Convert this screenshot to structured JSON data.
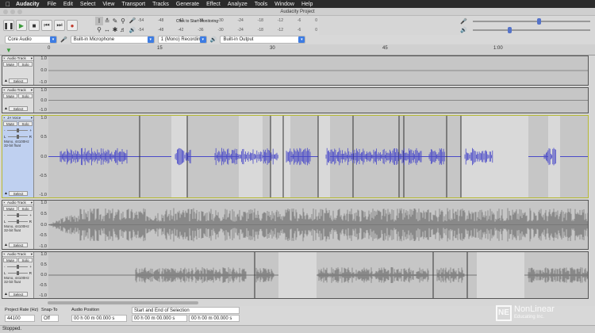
{
  "menubar": {
    "app": "Audacity",
    "items": [
      "File",
      "Edit",
      "Select",
      "View",
      "Transport",
      "Tracks",
      "Generate",
      "Effect",
      "Analyze",
      "Tools",
      "Window",
      "Help"
    ]
  },
  "window": {
    "title": "Audacity Project"
  },
  "meters": {
    "monitor_label": "Click to Start Monitoring",
    "record_scale": [
      "-54",
      "-48",
      "-42",
      "-36",
      "-30",
      "-24",
      "-18",
      "-12",
      "-6",
      "0"
    ],
    "play_scale": [
      "-54",
      "-48",
      "-42",
      "-36",
      "-30",
      "-24",
      "-18",
      "-12",
      "-6",
      "0"
    ]
  },
  "devices": {
    "host": "Core Audio",
    "input": "Built-in Microphone",
    "channels": "1 (Mono) Recordin...",
    "output": "Built-in Output"
  },
  "ruler": {
    "ticks": [
      "0",
      "15",
      "30",
      "45",
      "1:00"
    ]
  },
  "tracks": [
    {
      "name": "Audio Track",
      "mute": "Mute",
      "solo": "Solo",
      "select": "Select",
      "scale": [
        "1.0",
        "0.0",
        "-1.0"
      ],
      "info": ""
    },
    {
      "name": "Audio Track",
      "mute": "Mute",
      "solo": "Solo",
      "select": "Select",
      "scale": [
        "1.0",
        "0.0",
        "-1.0"
      ],
      "info": ""
    },
    {
      "name": "JA Voice",
      "mute": "Mute",
      "solo": "Solo",
      "select": "Select",
      "scale": [
        "1.0",
        "0.5",
        "0.0",
        "-0.5",
        "-1.0"
      ],
      "info": "Mono, 44100Hz 32-bit float"
    },
    {
      "name": "Audio Track",
      "mute": "Mute",
      "solo": "Solo",
      "select": "Select",
      "scale": [
        "1.0",
        "0.5",
        "0.0",
        "-0.5",
        "-1.0"
      ],
      "info": "Mono, 44100Hz 32-bit float"
    },
    {
      "name": "Audio Track",
      "mute": "Mute",
      "solo": "Solo",
      "select": "Select",
      "scale": [
        "1.0",
        "0.5",
        "0.0",
        "-0.5",
        "-1.0"
      ],
      "info": "Mono, 44100Hz 32-bit float"
    }
  ],
  "selection": {
    "rate_label": "Project Rate (Hz)",
    "rate_value": "44100",
    "snap_label": "Snap-To",
    "snap_value": "Off",
    "pos_label": "Audio Position",
    "pos_value": "00 h 00 m 00.000 s",
    "mode": "Start and End of Selection",
    "start": "00 h 00 m 00.000 s",
    "end": "00 h 00 m 00.000 s"
  },
  "status": "Stopped.",
  "watermark": {
    "brand": "NonLinear",
    "sub": "Educating Inc."
  },
  "colors": {
    "voice_wave": "#4a4ac8",
    "wave": "#7a7a7a",
    "selected_track_border": "#b6b833"
  }
}
